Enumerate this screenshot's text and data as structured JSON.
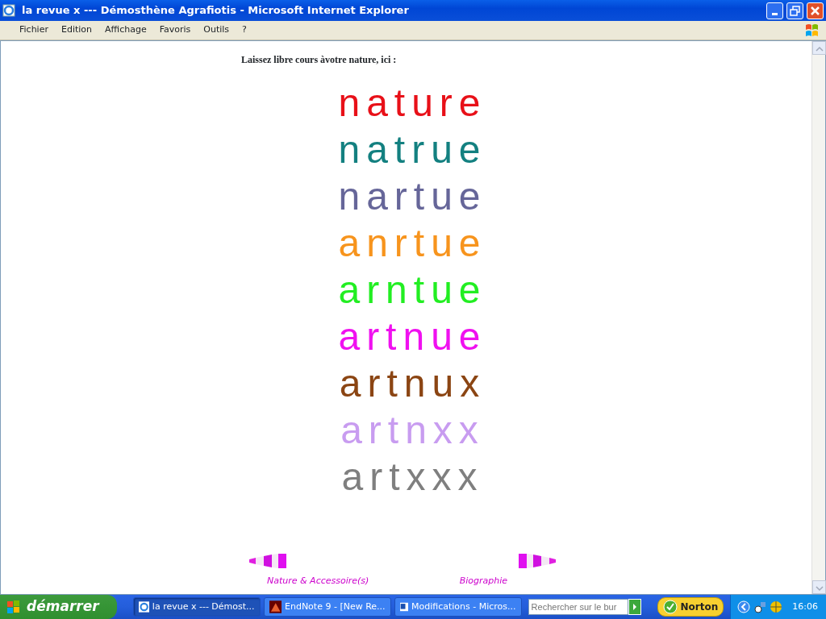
{
  "window": {
    "title": "la revue x --- Démosthène Agrafiotis - Microsoft Internet Explorer"
  },
  "menu": [
    "Fichier",
    "Edition",
    "Affichage",
    "Favoris",
    "Outils",
    "?"
  ],
  "content": {
    "heading": "Laissez libre cours àvotre nature, ici :",
    "words": [
      {
        "text": "nature",
        "color": "#e81018"
      },
      {
        "text": "natrue",
        "color": "#138080"
      },
      {
        "text": "nartue",
        "color": "#666699"
      },
      {
        "text": "anrtue",
        "color": "#f7941d"
      },
      {
        "text": "arntue",
        "color": "#22ee22"
      },
      {
        "text": "artnue",
        "color": "#f010f0"
      },
      {
        "text": "artnux",
        "color": "#8b4513"
      },
      {
        "text": "artnxx",
        "color": "#c89cf0"
      },
      {
        "text": "artxxx",
        "color": "#7f7f7f"
      }
    ],
    "nav": [
      {
        "label": "Nature & Accessoire(s)",
        "kind": "back"
      },
      {
        "label": "Biographie",
        "kind": "forward"
      }
    ]
  },
  "taskbar": {
    "start": "démarrer",
    "tasks": [
      {
        "label": "la revue x --- Démost...",
        "kind": "browser",
        "selected": true
      },
      {
        "label": "EndNote 9 - [New Re...",
        "kind": "endnote",
        "selected": false
      },
      {
        "label": "Modifications - Micros...",
        "kind": "word",
        "selected": false
      }
    ],
    "search": {
      "placeholder": "Rechercher sur le bur"
    },
    "norton": "Norton",
    "clock": "16:06"
  }
}
